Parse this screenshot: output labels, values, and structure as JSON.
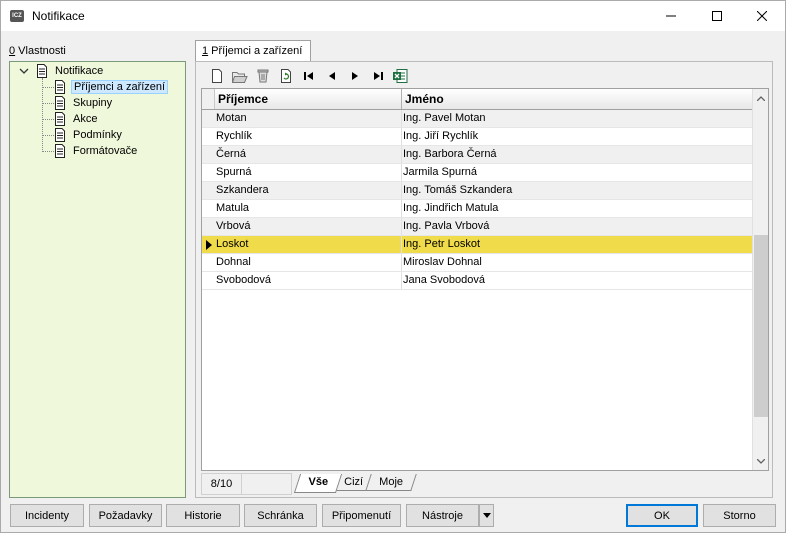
{
  "window": {
    "title": "Notifikace",
    "app_icon_text": "ICZ"
  },
  "left_panel": {
    "label_key": "0",
    "label_rest": " Vlastnosti",
    "tree": {
      "root": "Notifikace",
      "items": [
        {
          "label": "Příjemci a zařízení",
          "selected": true
        },
        {
          "label": "Skupiny",
          "selected": false
        },
        {
          "label": "Akce",
          "selected": false
        },
        {
          "label": "Podmínky",
          "selected": false
        },
        {
          "label": "Formátovače",
          "selected": false
        }
      ]
    }
  },
  "main_tab": {
    "key": "1",
    "label": " Příjemci a zařízení"
  },
  "toolbar": {
    "buttons": [
      "new-icon",
      "open-icon",
      "delete-icon",
      "refresh-icon",
      "first-icon",
      "prev-icon",
      "next-icon",
      "last-icon",
      "excel-icon"
    ]
  },
  "grid": {
    "columns": [
      "Příjemce",
      "Jméno"
    ],
    "rows": [
      [
        "Motan",
        "Ing. Pavel Motan"
      ],
      [
        "Rychlík",
        "Ing. Jiří Rychlík"
      ],
      [
        "Černá",
        "Ing. Barbora Černá"
      ],
      [
        "Spurná",
        "Jarmila Spurná"
      ],
      [
        "Szkandera",
        "Ing. Tomáš Szkandera"
      ],
      [
        "Matula",
        "Ing. Jindřich Matula"
      ],
      [
        "Vrbová",
        "Ing. Pavla Vrbová"
      ],
      [
        "Loskot",
        "Ing. Petr Loskot"
      ],
      [
        "Dohnal",
        "Miroslav Dohnal"
      ],
      [
        "Svobodová",
        "Jana Svobodová"
      ]
    ],
    "selected_row": 7
  },
  "status": {
    "count": "8/10",
    "subtabs": [
      "Vše",
      "Cizí",
      "Moje"
    ],
    "active_subtab": 0
  },
  "bottom_buttons": {
    "incidenty": "Incidenty",
    "pozadavky": "Požadavky",
    "historie": "Historie",
    "schranka": "Schránka",
    "pripomenuti": "Připomenutí",
    "nastroje": "Nástroje",
    "ok": "OK",
    "storno": "Storno"
  },
  "colors": {
    "tree_bg": "#f0f8dc",
    "selected_row": "#f0dc4a",
    "tree_selected": "#cde8ff",
    "primary_border": "#0078d7"
  }
}
